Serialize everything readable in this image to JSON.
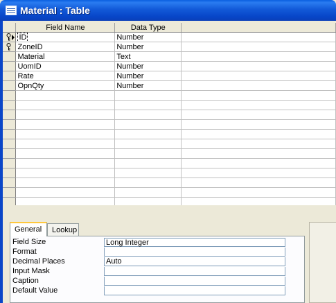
{
  "window": {
    "title": "Material : Table"
  },
  "grid": {
    "columns": [
      "Field Name",
      "Data Type"
    ],
    "rows": [
      {
        "field": "ID",
        "type": "Number",
        "key": true,
        "current": true
      },
      {
        "field": "ZoneID",
        "type": "Number",
        "key": true,
        "current": false
      },
      {
        "field": "Material",
        "type": "Text",
        "key": false,
        "current": false
      },
      {
        "field": "UomID",
        "type": "Number",
        "key": false,
        "current": false
      },
      {
        "field": "Rate",
        "type": "Number",
        "key": false,
        "current": false
      },
      {
        "field": "OpnQty",
        "type": "Number",
        "key": false,
        "current": false
      }
    ],
    "empty_rows": 13
  },
  "tabs": [
    "General",
    "Lookup"
  ],
  "properties": [
    {
      "label": "Field Size",
      "value": "Long Integer"
    },
    {
      "label": "Format",
      "value": ""
    },
    {
      "label": "Decimal Places",
      "value": "Auto"
    },
    {
      "label": "Input Mask",
      "value": ""
    },
    {
      "label": "Caption",
      "value": ""
    },
    {
      "label": "Default Value",
      "value": ""
    }
  ]
}
